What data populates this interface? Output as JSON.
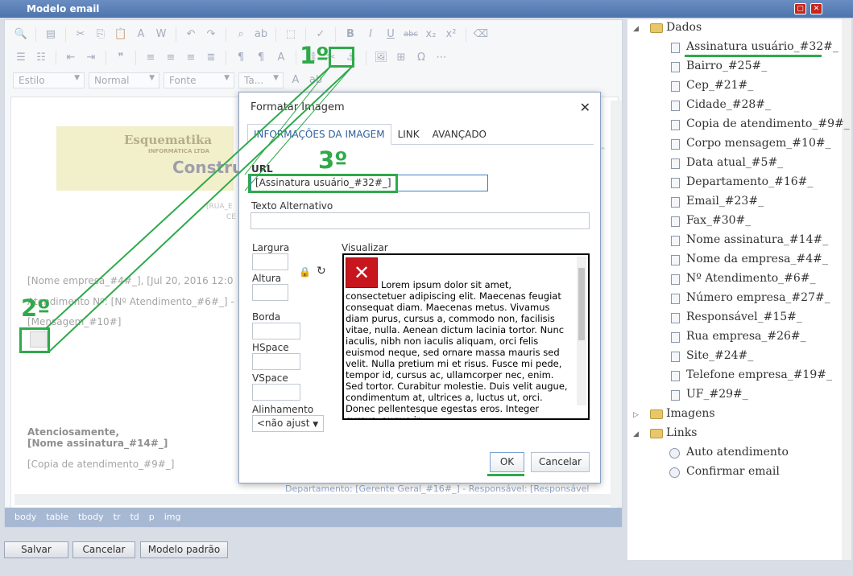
{
  "window": {
    "title": "Modelo email",
    "max_icon": "maximize-icon",
    "close_icon": "close-icon"
  },
  "editor": {
    "combos": [
      {
        "label": "Estilo"
      },
      {
        "label": "Normal"
      },
      {
        "label": "Fonte"
      },
      {
        "label": "Ta..."
      }
    ],
    "logo": {
      "title": "Esquematika",
      "sub": "INFORMÁTICA LTDA",
      "big": "Constru"
    },
    "address": {
      "line1": "[RUA_E",
      "line2": "CE"
    },
    "lines": {
      "empresa": "[Nome empresa_#4#_], [Jul 20, 2016 12:0",
      "atendimento": "Atendimento Nº: [Nº Atendimento_#6#_] -",
      "mensagem": "[Mensagem_#10#]",
      "atenciosamente": "Atenciosamente,",
      "assinatura": "[Nome assinatura_#14#_]",
      "copia": "[Copia de atendimento_#9#_]",
      "departamento": "Departamento: [Gerente Geral_#16#_] - Responsável: [Responsável"
    },
    "path": [
      "body",
      "table",
      "tbody",
      "tr",
      "td",
      "p",
      "img"
    ]
  },
  "dialog": {
    "title": "Formatar Imagem",
    "tabs": [
      "INFORMAÇÕES DA IMAGEM",
      "LINK",
      "AVANÇADO"
    ],
    "url_label": "URL",
    "url_value": "[Assinatura usuário_#32#_]",
    "alt_label": "Texto Alternativo",
    "largura_label": "Largura",
    "altura_label": "Altura",
    "borda_label": "Borda",
    "hspace_label": "HSpace",
    "vspace_label": "VSpace",
    "alinhamento_label": "Alinhamento",
    "alinhamento_value": "<não ajust",
    "preview_label": "Visualizar",
    "preview_text": "Lorem ipsum dolor sit amet, consectetuer adipiscing elit. Maecenas feugiat consequat diam. Maecenas metus. Vivamus diam purus, cursus a, commodo non, facilisis vitae, nulla. Aenean dictum lacinia tortor. Nunc iaculis, nibh non iaculis aliquam, orci felis euismod neque, sed ornare massa mauris sed velit. Nulla pretium mi et risus. Fusce mi pede, tempor id, cursus ac, ullamcorper nec, enim. Sed tortor. Curabitur molestie. Duis velit augue, condimentum at, ultrices a, luctus ut, orci. Donec pellentesque egestas eros. Integer cursus, augue in",
    "ok": "OK",
    "cancel": "Cancelar"
  },
  "tree": {
    "dados": "Dados",
    "items": [
      "Assinatura usuário_#32#_",
      "Bairro_#25#_",
      "Cep_#21#_",
      "Cidade_#28#_",
      "Copia de atendimento_#9#_",
      "Corpo mensagem_#10#_",
      "Data atual_#5#_",
      "Departamento_#16#_",
      "Email_#23#_",
      "Fax_#30#_",
      "Nome assinatura_#14#_",
      "Nome da empresa_#4#_",
      "Nº Atendimento_#6#_",
      "Número empresa_#27#_",
      "Responsável_#15#_",
      "Rua empresa_#26#_",
      "Site_#24#_",
      "Telefone empresa_#19#_",
      "UF_#29#_"
    ],
    "imagens": "Imagens",
    "links": "Links",
    "link_items": [
      "Auto atendimento",
      "Confirmar email"
    ]
  },
  "buttons": {
    "salvar": "Salvar",
    "cancelar": "Cancelar",
    "modelo": "Modelo padrão"
  },
  "annotations": {
    "step1": "1º",
    "step2": "2º",
    "step3": "3º",
    "color": "#2eaa4a"
  }
}
